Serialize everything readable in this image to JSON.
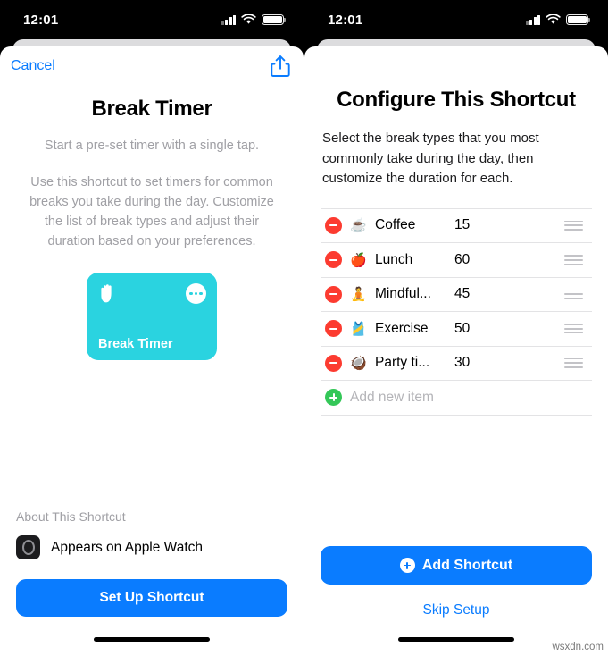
{
  "status_bar": {
    "time": "12:01",
    "signal_icon": "cellular-bars-icon",
    "wifi_icon": "wifi-icon",
    "battery_icon": "battery-icon"
  },
  "left_screen": {
    "nav": {
      "cancel_label": "Cancel",
      "share_icon": "share-icon"
    },
    "title": "Break Timer",
    "subtitle": "Start a pre-set timer with a single tap.",
    "description": "Use this shortcut to set timers for common breaks you take during the day. Customize the list of break types and adjust their duration based on your preferences.",
    "tile": {
      "label": "Break Timer",
      "glyph_icon": "raised-hand-icon",
      "more_icon": "ellipsis-icon",
      "color": "#2AD3E0"
    },
    "about": {
      "heading": "About This Shortcut",
      "row_icon": "apple-watch-icon",
      "row_label": "Appears on Apple Watch"
    },
    "primary_button": "Set Up Shortcut"
  },
  "right_screen": {
    "title": "Configure This Shortcut",
    "description": "Select the break types that you most commonly take during the day, then customize the duration for each.",
    "list": [
      {
        "emoji": "☕",
        "emoji_name": "coffee-icon",
        "name": "Coffee",
        "duration": "15"
      },
      {
        "emoji": "🍎",
        "emoji_name": "apple-icon",
        "name": "Lunch",
        "duration": "60"
      },
      {
        "emoji": "🧘",
        "emoji_name": "meditation-icon",
        "name": "Mindful...",
        "duration": "45"
      },
      {
        "emoji": "🎽",
        "emoji_name": "running-shirt-icon",
        "name": "Exercise",
        "duration": "50"
      },
      {
        "emoji": "🥥",
        "emoji_name": "coconut-drink-icon",
        "name": "Party ti...",
        "duration": "30"
      }
    ],
    "add_new_label": "Add new item",
    "remove_icon": "minus-circle-icon",
    "add_icon": "plus-circle-icon",
    "reorder_icon": "drag-handle-icon",
    "add_shortcut_button": "Add Shortcut",
    "skip_button": "Skip Setup"
  },
  "watermark": "wsxdn.com",
  "colors": {
    "accent_blue": "#0A7CFF",
    "destructive_red": "#FC3B30",
    "add_green": "#34C758",
    "tile_cyan": "#2AD3E0"
  }
}
